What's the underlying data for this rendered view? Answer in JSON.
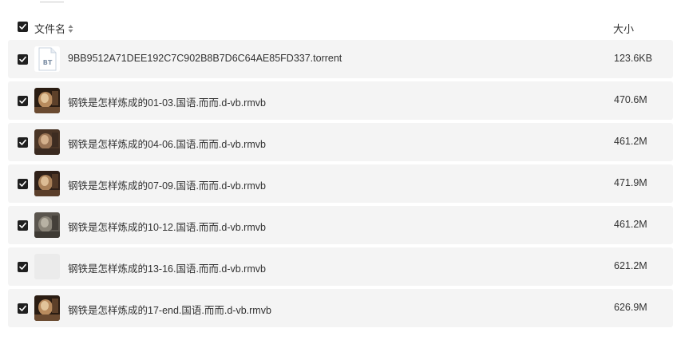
{
  "header": {
    "name_label": "文件名",
    "size_label": "大小",
    "select_all_checked": true
  },
  "files": [
    {
      "name": "9BB9512A71DEE192C7C902B8B7D6C64AE85FD337.torrent",
      "size": "123.6KB",
      "thumb": "bt-file-icon",
      "checked": true
    },
    {
      "name": "钢铁是怎样炼成的01-03.国语.而而.d-vb.rmvb",
      "size": "470.6M",
      "thumb": "video-thumbnail",
      "checked": true
    },
    {
      "name": "钢铁是怎样炼成的04-06.国语.而而.d-vb.rmvb",
      "size": "461.2M",
      "thumb": "video-thumbnail",
      "checked": true
    },
    {
      "name": "钢铁是怎样炼成的07-09.国语.而而.d-vb.rmvb",
      "size": "471.9M",
      "thumb": "video-thumbnail",
      "checked": true
    },
    {
      "name": "钢铁是怎样炼成的10-12.国语.而而.d-vb.rmvb",
      "size": "461.2M",
      "thumb": "video-thumbnail",
      "checked": true
    },
    {
      "name": "钢铁是怎样炼成的13-16.国语.而而.d-vb.rmvb",
      "size": "621.2M",
      "thumb": "blank-thumbnail",
      "checked": true
    },
    {
      "name": "钢铁是怎样炼成的17-end.国语.而而.d-vb.rmvb",
      "size": "626.9M",
      "thumb": "video-thumbnail",
      "checked": true
    }
  ],
  "colors": {
    "row_background": "#f4f4f4",
    "checkbox": "#1f1f1f",
    "text": "#333333"
  }
}
